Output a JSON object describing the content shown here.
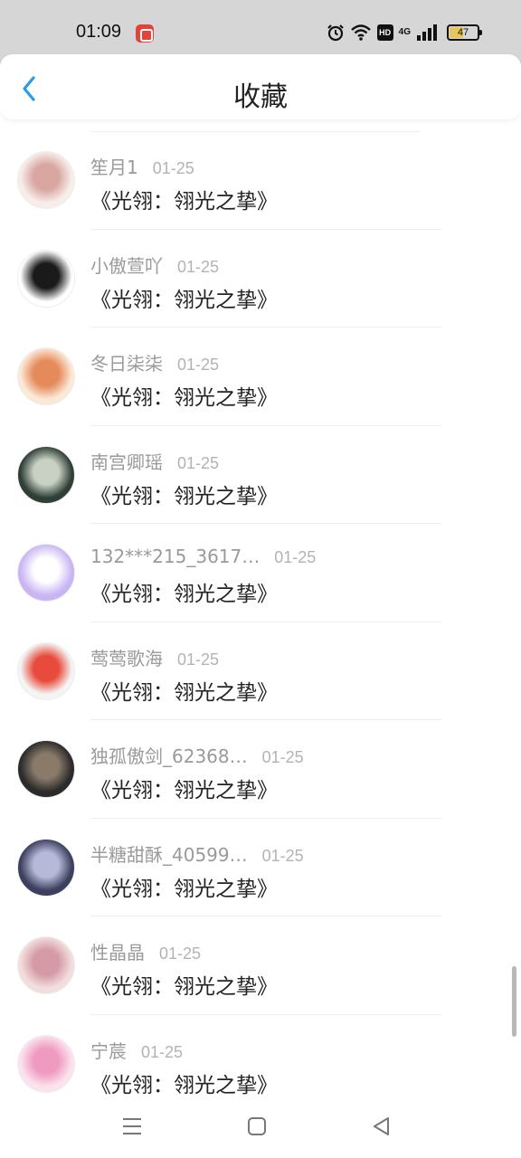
{
  "status_bar": {
    "time": "01:09",
    "network_label": "4G",
    "hd_label": "HD",
    "battery_level": 47,
    "battery_label": "47",
    "icons": [
      "app-notification-icon",
      "alarm-icon",
      "wifi-icon",
      "signal-icon",
      "battery-icon"
    ]
  },
  "header": {
    "title": "收藏",
    "back_icon": "chevron-left-icon",
    "accent_color": "#2d9ae8"
  },
  "items": [
    {
      "username": "笙月1",
      "date": "01-25",
      "title": "《光翎：翎光之挚》",
      "avatar_colors": [
        "#f7eeea",
        "#d9a6a2"
      ]
    },
    {
      "username": "小傲萱吖",
      "date": "01-25",
      "title": "《光翎：翎光之挚》",
      "avatar_colors": [
        "#ffffff",
        "#1a1a1a"
      ]
    },
    {
      "username": "冬日柒柒",
      "date": "01-25",
      "title": "《光翎：翎光之挚》",
      "avatar_colors": [
        "#fbe9d8",
        "#e58a5a"
      ]
    },
    {
      "username": "南宫卿瑶",
      "date": "01-25",
      "title": "《光翎：翎光之挚》",
      "avatar_colors": [
        "#2f3e36",
        "#c8d2c4"
      ]
    },
    {
      "username": "132***215_3617…",
      "date": "01-25",
      "title": "《光翎：翎光之挚》",
      "avatar_colors": [
        "#c9b5f4",
        "#ffffff"
      ]
    },
    {
      "username": "莺莺歌海",
      "date": "01-25",
      "title": "《光翎：翎光之挚》",
      "avatar_colors": [
        "#f4f4f4",
        "#e84a3c"
      ]
    },
    {
      "username": "独孤傲剑_62368…",
      "date": "01-25",
      "title": "《光翎：翎光之挚》",
      "avatar_colors": [
        "#2b2b2b",
        "#8a7a6a"
      ]
    },
    {
      "username": "半糖甜酥_40599…",
      "date": "01-25",
      "title": "《光翎：翎光之挚》",
      "avatar_colors": [
        "#3d3f5e",
        "#b7b9d8"
      ]
    },
    {
      "username": "性晶晶",
      "date": "01-25",
      "title": "《光翎：翎光之挚》",
      "avatar_colors": [
        "#f3dede",
        "#d49aa6"
      ]
    },
    {
      "username": "宁莀",
      "date": "01-25",
      "title": "《光翎：翎光之挚》",
      "avatar_colors": [
        "#fbe3ee",
        "#ef9bc1"
      ]
    }
  ],
  "nav_bar": {
    "icons": [
      "menu-icon",
      "home-square-icon",
      "back-triangle-icon"
    ]
  }
}
